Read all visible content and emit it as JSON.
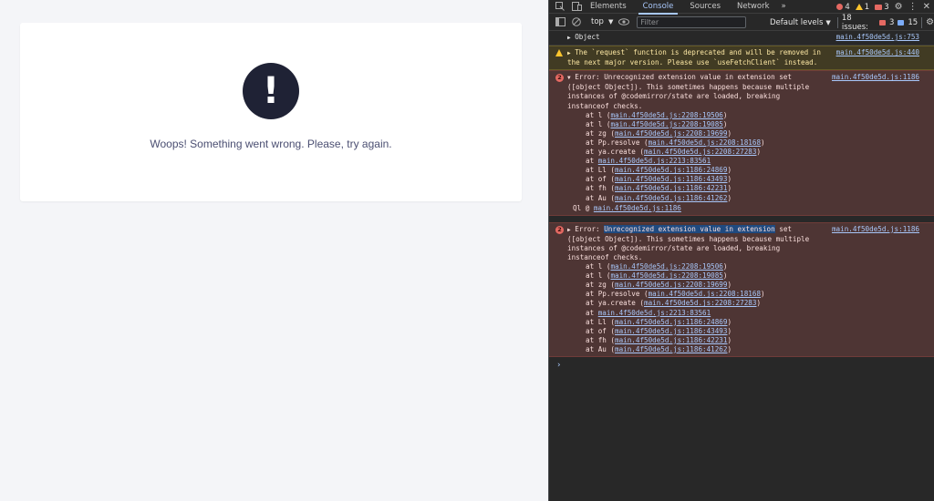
{
  "page": {
    "error_icon": "exclamation",
    "error_message": "Woops! Something went wrong. Please, try again."
  },
  "devtools": {
    "tabs": [
      "Elements",
      "Console",
      "Sources",
      "Network"
    ],
    "active_tab": "Console",
    "counts": {
      "errors": "4",
      "warnings": "1",
      "messages": "3"
    },
    "toolbar": {
      "context": "top",
      "filter_placeholder": "Filter",
      "levels": "Default levels",
      "issues_label": "18 issues:",
      "issues_errors": "3",
      "issues_info": "15"
    },
    "console": {
      "object_row": {
        "text": "Object",
        "source": "main.4f50de5d.js:753"
      },
      "warning": {
        "text": "The `request` function is deprecated and will be removed in the next major version. Please use `useFetchClient` instead.",
        "source": "main.4f50de5d.js:440"
      },
      "error1": {
        "count": "2",
        "head": "Error: Unrecognized extension value in extension set ([object Object]). This sometimes happens because multiple instances of @codemirror/state are loaded, breaking instanceof checks.",
        "source": "main.4f50de5d.js:1186",
        "stack": [
          {
            "fn": "at l (",
            "link": "main.4f50de5d.js:2208:19506",
            "end": ")"
          },
          {
            "fn": "at l (",
            "link": "main.4f50de5d.js:2208:19085",
            "end": ")"
          },
          {
            "fn": "at zg (",
            "link": "main.4f50de5d.js:2208:19699",
            "end": ")"
          },
          {
            "fn": "at Pp.resolve (",
            "link": "main.4f50de5d.js:2208:18168",
            "end": ")"
          },
          {
            "fn": "at ya.create (",
            "link": "main.4f50de5d.js:2208:27283",
            "end": ")"
          },
          {
            "fn": "at ",
            "link": "main.4f50de5d.js:2213:83561",
            "end": ""
          },
          {
            "fn": "at Ll (",
            "link": "main.4f50de5d.js:1186:24869",
            "end": ")"
          },
          {
            "fn": "at of (",
            "link": "main.4f50de5d.js:1186:43493",
            "end": ")"
          },
          {
            "fn": "at fh (",
            "link": "main.4f50de5d.js:1186:42231",
            "end": ")"
          },
          {
            "fn": "at Au (",
            "link": "main.4f50de5d.js:1186:41262",
            "end": ")"
          }
        ],
        "origin_prefix": "Ql @ ",
        "origin_link": "main.4f50de5d.js:1186"
      },
      "error2": {
        "count": "2",
        "head_prefix": "Error: ",
        "head_highlight": "Unrecognized extension value in extension",
        "head_suffix": " set ([object Object]). This sometimes happens because multiple instances of @codemirror/state are loaded, breaking instanceof checks.",
        "source": "main.4f50de5d.js:1186",
        "stack": [
          {
            "fn": "at l (",
            "link": "main.4f50de5d.js:2208:19506",
            "end": ")"
          },
          {
            "fn": "at l (",
            "link": "main.4f50de5d.js:2208:19085",
            "end": ")"
          },
          {
            "fn": "at zg (",
            "link": "main.4f50de5d.js:2208:19699",
            "end": ")"
          },
          {
            "fn": "at Pp.resolve (",
            "link": "main.4f50de5d.js:2208:18168",
            "end": ")"
          },
          {
            "fn": "at ya.create (",
            "link": "main.4f50de5d.js:2208:27283",
            "end": ")"
          },
          {
            "fn": "at ",
            "link": "main.4f50de5d.js:2213:83561",
            "end": ""
          },
          {
            "fn": "at Ll (",
            "link": "main.4f50de5d.js:1186:24869",
            "end": ")"
          },
          {
            "fn": "at of (",
            "link": "main.4f50de5d.js:1186:43493",
            "end": ")"
          },
          {
            "fn": "at fh (",
            "link": "main.4f50de5d.js:1186:42231",
            "end": ")"
          },
          {
            "fn": "at Au (",
            "link": "main.4f50de5d.js:1186:41262",
            "end": ")"
          }
        ]
      },
      "prompt": "›"
    }
  }
}
